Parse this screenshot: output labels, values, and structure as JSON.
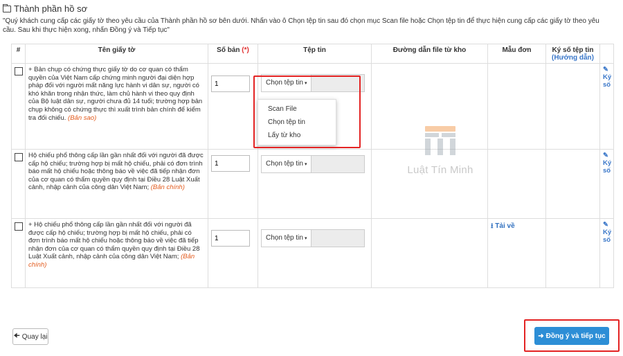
{
  "header": {
    "title": "Thành phần hồ sơ",
    "icon": "folder-open-icon"
  },
  "instruction": "\"Quý khách cung cấp các giấy tờ theo yêu cầu của Thành phần hồ sơ bên dưới. Nhấn vào ô Chọn tệp tin sau đó chọn mục Scan file hoặc Chọn tệp tin để thực hiện cung cấp các giấy tờ theo yêu cầu. Sau khi thực hiện xong, nhấn Đồng ý và Tiếp tục\"",
  "table": {
    "headers": {
      "number": "#",
      "doc_name": "Tên giấy tờ",
      "copies": "Số bản",
      "copies_required": "(*)",
      "file": "Tệp tin",
      "storage_path": "Đường dẫn file từ kho",
      "form_template": "Mẫu đơn",
      "sign_file": "Ký số tệp tin",
      "sign_guide": "(Hướng dẫn)"
    },
    "rows": [
      {
        "doc_name": "+ Bản chụp có chứng thực giấy tờ do cơ quan có thẩm quyền của Việt Nam cấp chứng minh người đại diện hợp pháp đối với người mất năng lực hành vi dân sự, người có khó khăn trong nhận thức, làm chủ hành vi theo quy định của Bộ luật dân sự, người chưa đủ 14 tuổi; trường hợp bản chụp không có chứng thực thì xuất trình bản chính để kiểm tra đối chiếu.",
        "doc_type": "(Bản sao)",
        "copies": "1",
        "file_button": "Chọn tệp tin",
        "download": "",
        "sign_label": "Ký số"
      },
      {
        "doc_name": "Hộ chiếu phổ thông cấp lần gần nhất đối với người đã được cấp hộ chiếu; trường hợp bị mất hộ chiếu, phải có đơn trình báo mất hộ chiếu hoặc thông báo về việc đã tiếp nhận đơn của cơ quan có thẩm quyền quy định tại Điều 28 Luật Xuất cảnh, nhập cảnh của công dân Việt Nam;",
        "doc_type": "(Bản chính)",
        "copies": "1",
        "file_button": "Chọn tệp tin",
        "download": "",
        "sign_label": "Ký số"
      },
      {
        "doc_name": "+ Hộ chiếu phổ thông cấp lần gần nhất đối với người đã được cấp hộ chiếu; trường hợp bị mất hộ chiếu, phải có đơn trình báo mất hộ chiếu hoặc thông báo về việc đã tiếp nhận đơn của cơ quan có thẩm quyền quy định tại Điều 28 Luật Xuất cảnh, nhập cảnh của công dân Việt Nam;",
        "doc_type": "(Bản chính)",
        "copies": "1",
        "file_button": "Chọn tệp tin",
        "download": "Tải về",
        "sign_label": "Ký số"
      }
    ]
  },
  "dropdown": {
    "options": [
      "Scan File",
      "Chọn tệp tin",
      "Lấy từ kho"
    ]
  },
  "watermark": {
    "text": "Luật Tín Minh"
  },
  "footer": {
    "back_label": "Quay lại",
    "next_label": "Đồng ý và tiếp tục"
  },
  "colors": {
    "highlight": "#e32323",
    "primary_button": "#2d8ed6",
    "doc_type": "#e2591b",
    "link": "#3a77c9",
    "watermark_orange": "#f3a35c"
  }
}
